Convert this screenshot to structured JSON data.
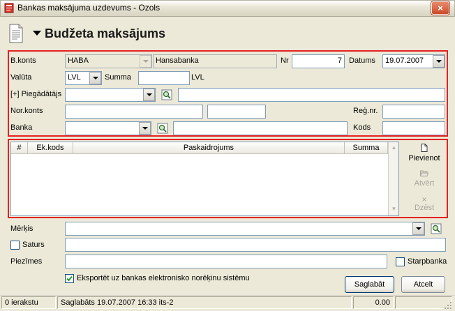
{
  "window": {
    "title": "Bankas maksājuma uzdevums - Ozols",
    "close_glyph": "×"
  },
  "header": {
    "title": "Budžeta maksājums"
  },
  "top_form": {
    "bkonts_label": "B.konts",
    "bkonts_value": "HABA",
    "bank_name": "Hansabanka",
    "nr_label": "Nr",
    "nr_value": "7",
    "datums_label": "Datums",
    "datums_value": "19.07.2007",
    "valuta_label": "Valūta",
    "valuta_value": "LVL",
    "summa_label": "Summa",
    "summa_value": "",
    "summa_currency": "LVL",
    "piegadatajs_label": "[+] Piegādātājs",
    "piegadatajs_value": "",
    "piegadatajs_name": "",
    "norkonts_label": "Nor.konts",
    "norkonts_value": "",
    "norkonts_extra": "",
    "regnr_label": "Reģ.nr.",
    "regnr_value": "",
    "banka_label": "Banka",
    "banka_value": "",
    "banka_name": "",
    "kods_label": "Kods",
    "kods_value": ""
  },
  "grid": {
    "columns": [
      "#",
      "Ek.kods",
      "Paskaidrojums",
      "Summa"
    ],
    "rows": []
  },
  "side_buttons": {
    "add": "Pievienot",
    "open": "Atvērt",
    "delete": "Dzēst"
  },
  "bottom_form": {
    "merkis_label": "Mērķis",
    "merkis_value": "",
    "saturs_label": "Saturs",
    "saturs_value": "",
    "saturs_checked": false,
    "piezimes_label": "Piezīmes",
    "piezimes_value": "",
    "starpbanka_label": "Starpbanka",
    "starpbanka_checked": false,
    "export_label": "Eksportēt uz bankas elektronisko norēķinu sistēmu",
    "export_checked": true
  },
  "buttons": {
    "save": "Saglabāt",
    "cancel": "Atcelt"
  },
  "statusbar": {
    "records": "0 ierakstu",
    "saved": "Saglabāts 19.07.2007 16:33 its-2",
    "total": "0.00"
  },
  "colors": {
    "group_border": "#e52222",
    "field_border": "#7f9db9",
    "window_bg": "#ece9d8"
  }
}
